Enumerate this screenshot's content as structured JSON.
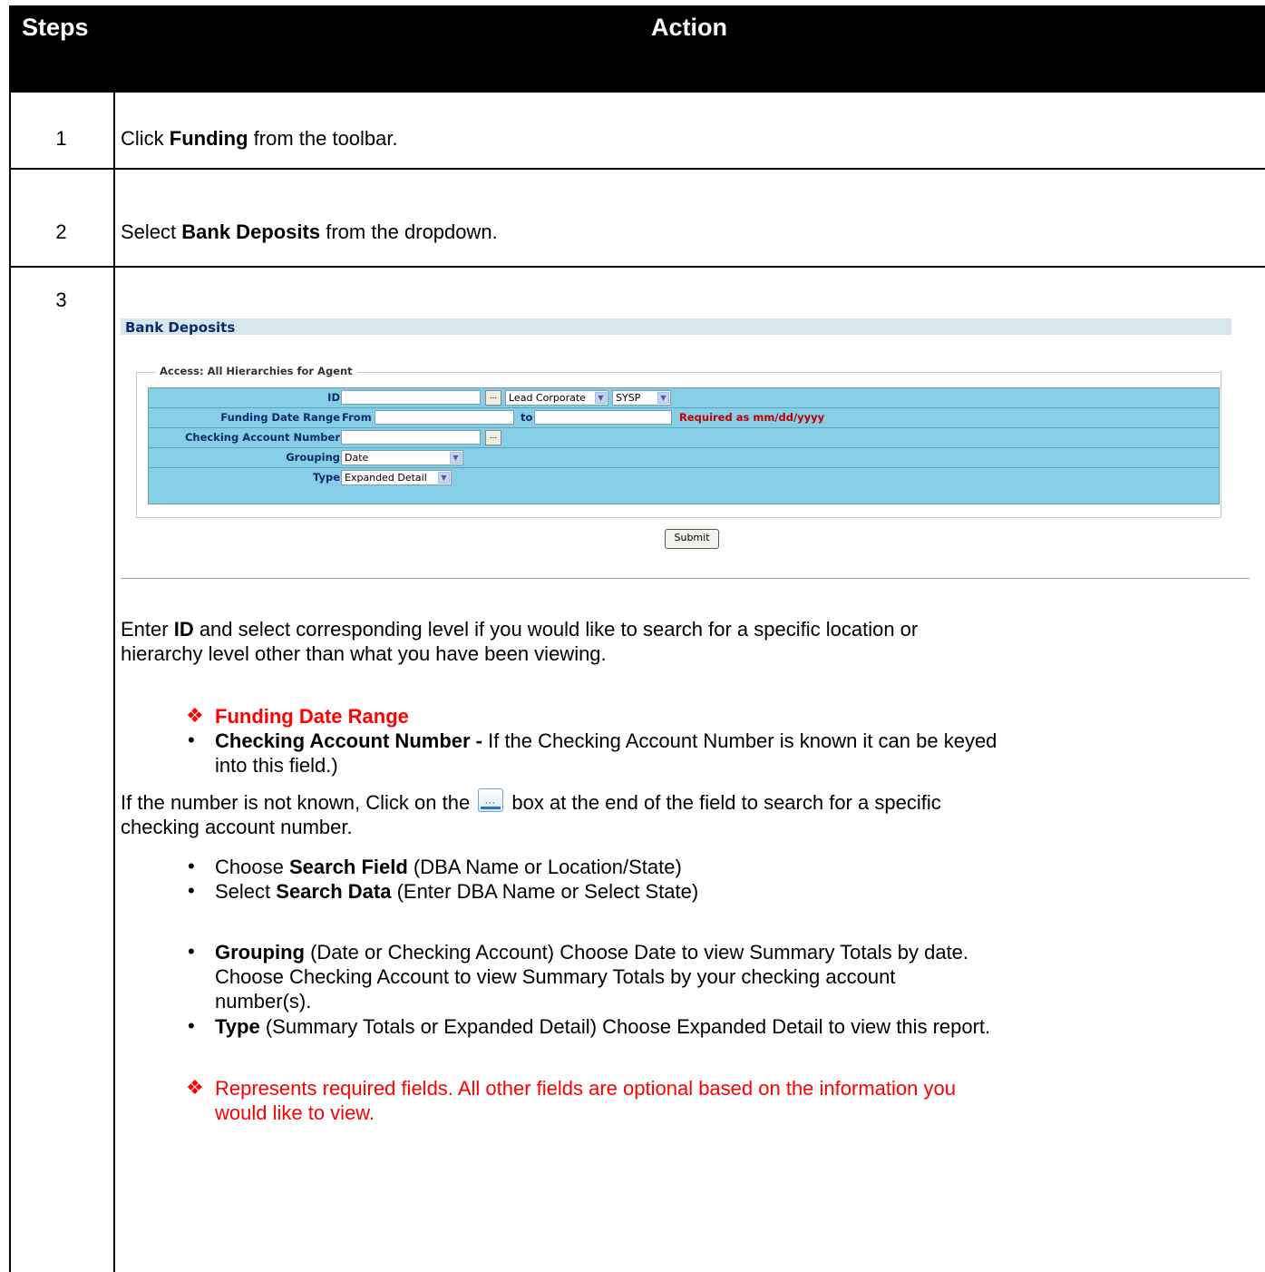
{
  "header": {
    "steps": "Steps",
    "action": "Action"
  },
  "steps": [
    {
      "num": "1",
      "pre": "Click ",
      "bold": "Funding",
      "post": " from the toolbar."
    },
    {
      "num": "2",
      "pre": "Select ",
      "bold": "Bank Deposits",
      "post": " from the dropdown."
    },
    {
      "num": "3"
    }
  ],
  "screenshot": {
    "title": "Bank Deposits",
    "legend": "Access: All Hierarchies for Agent",
    "id_label": "ID",
    "level_select": "Lead Corporate",
    "sys_select": "SYSP",
    "funding_label": "Funding Date Range",
    "from_label": "From",
    "to_label": "to",
    "required_note": "Required as mm/dd/yyyy",
    "checking_label": "Checking Account Number",
    "grouping_label": "Grouping",
    "grouping_value": "Date",
    "type_label": "Type",
    "type_value": "Expanded Detail",
    "submit": "Submit"
  },
  "body": {
    "p1_pre": "Enter ",
    "p1_bold": "ID",
    "p1_post": " and select corresponding level if you would like to search for a specific location or",
    "p1_line2": "hierarchy level other than what you have been viewing.",
    "req_field": "Funding Date Range",
    "checking_bold": "Checking Account Number -",
    "checking_text": " If the Checking Account Number is known it can be keyed",
    "checking_line2": "into this field.)",
    "p2_pre": "If the number is not known, Click on the ",
    "p2_post": " box at the end of the field to search for a specific",
    "p2_line2": "checking account number.",
    "search_field_pre": "Choose ",
    "search_field_bold": "Search Field",
    "search_field_post": " (DBA Name or Location/State)",
    "search_data_pre": "Select ",
    "search_data_bold": "Search Data",
    "search_data_post": " (Enter DBA Name or Select State)",
    "grouping_bold": "Grouping",
    "grouping_text": " (Date or Checking Account) Choose Date to view Summary Totals by date.",
    "grouping_line2": "Choose Checking Account to view Summary Totals by your checking account",
    "grouping_line3": "number(s).",
    "type_bold": "Type",
    "type_text": " (Summary Totals or Expanded Detail) Choose Expanded Detail to view this report.",
    "note_line1": "Represents required fields. All other fields are optional based on the information you",
    "note_line2": "would like to view."
  }
}
